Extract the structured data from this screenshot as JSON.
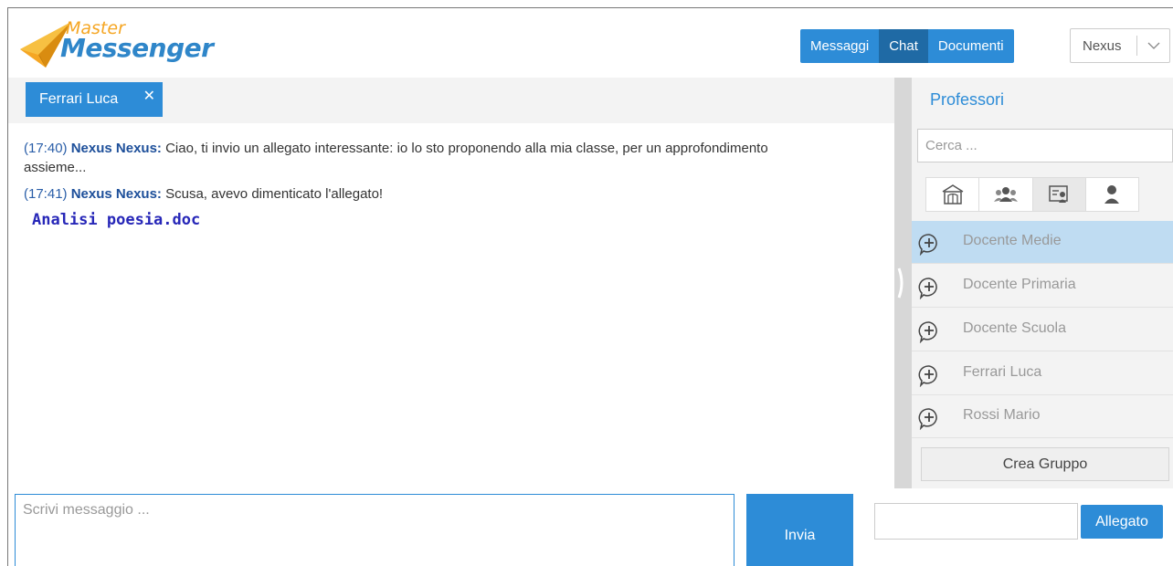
{
  "header": {
    "logo_top": "Master",
    "logo_bottom": "Messenger",
    "nav": [
      {
        "label": "Messaggi",
        "active": false
      },
      {
        "label": "Chat",
        "active": true
      },
      {
        "label": "Documenti",
        "active": false
      }
    ],
    "user": "Nexus"
  },
  "chat": {
    "open_tab": "Ferrari Luca",
    "messages": [
      {
        "time": "(17:40)",
        "author": "Nexus Nexus:",
        "text": "Ciao, ti invio un allegato interessante: io lo sto proponendo alla mia classe, per un approfondimento assieme..."
      },
      {
        "time": "(17:41)",
        "author": "Nexus Nexus:",
        "text": "Scusa, avevo dimenticato l'allegato!"
      }
    ],
    "attachment": "Analisi poesia.doc"
  },
  "panel": {
    "title": "Professori",
    "search_placeholder": "Cerca ...",
    "filters": [
      "school-building-icon",
      "group-icon",
      "id-card-icon",
      "person-icon"
    ],
    "active_filter": 2,
    "contacts": [
      {
        "name": "Docente Medie",
        "selected": true
      },
      {
        "name": "Docente Primaria",
        "selected": false
      },
      {
        "name": "Docente Scuola",
        "selected": false
      },
      {
        "name": "Ferrari Luca",
        "selected": false
      },
      {
        "name": "Rossi Mario",
        "selected": false
      }
    ],
    "create_group": "Crea Gruppo"
  },
  "compose": {
    "placeholder": "Scrivi messaggio ...",
    "send_label": "Invia",
    "attach_label": "Allegato"
  },
  "colors": {
    "accent": "#2d8cd7",
    "accent_dark": "#1f6aa5",
    "selected_row": "#bfdcf2",
    "author": "#1d4f9a"
  }
}
